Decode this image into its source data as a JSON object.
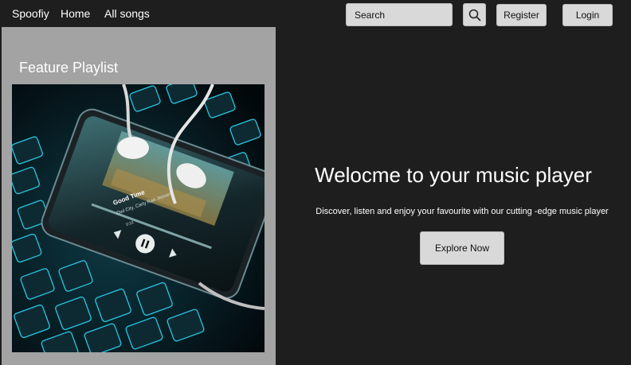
{
  "nav": {
    "brand": "Spoofiy",
    "links": [
      "Home",
      "All songs"
    ],
    "search_placeholder": "Search",
    "register_label": "Register",
    "login_label": "Login"
  },
  "sidebar": {
    "title": "Feature Playlist",
    "image": {
      "track_title": "Good Time",
      "track_artist": "Owl City, Carly Rae Jepsen",
      "time_elapsed": "0:22"
    }
  },
  "hero": {
    "title": "Welocme to your music player",
    "subtitle": "Discover, listen and enjoy your favourite with our cutting -edge music player",
    "cta_label": "Explore Now"
  },
  "colors": {
    "background": "#1e1e1e",
    "panel": "#a3a3a3",
    "button": "#d9d9d9",
    "keyboard_glow": "#29c6e0"
  }
}
